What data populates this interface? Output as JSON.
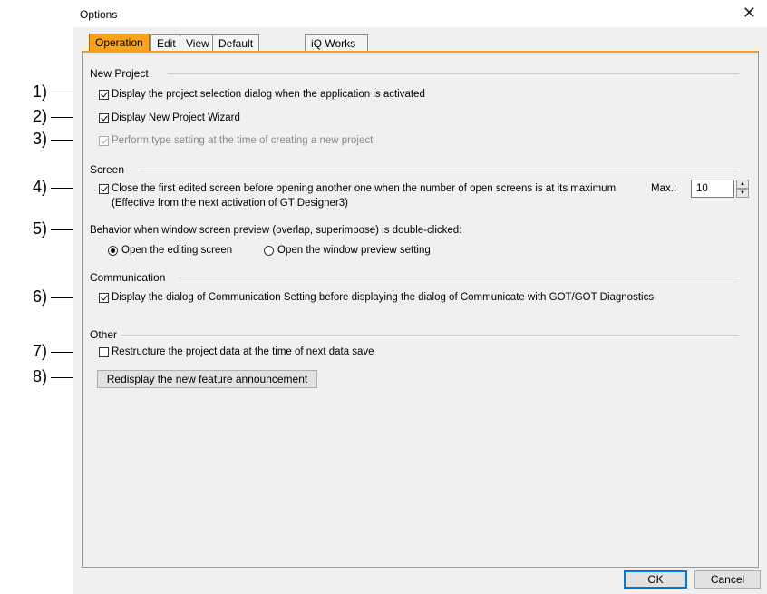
{
  "dialog": {
    "title": "Options"
  },
  "tabs": [
    "Operation",
    "Edit",
    "View",
    "Default Setting",
    "iQ Works Interaction"
  ],
  "callouts": [
    "1)",
    "2)",
    "3)",
    "4)",
    "5)",
    "6)",
    "7)",
    "8)"
  ],
  "sections": {
    "new_project": "New Project",
    "screen": "Screen",
    "communication": "Communication",
    "other": "Other"
  },
  "options": {
    "project_selection": "Display the project selection dialog when the application is activated",
    "new_project_wizard": "Display New Project Wizard",
    "type_setting": "Perform type setting at the time of creating a new project",
    "close_first_screen": "Close the first edited screen before opening another one when the number of open screens is at its maximum",
    "close_first_screen_note": "(Effective from the next activation of GT Designer3)",
    "max_label": "Max.:",
    "max_value": "10",
    "behavior_label": "Behavior when window screen preview (overlap, superimpose) is double-clicked:",
    "radio_open_editing": "Open the editing screen",
    "radio_open_preview": "Open the window preview setting",
    "comm_setting": "Display the dialog of Communication Setting before displaying the dialog of Communicate with GOT/GOT Diagnostics",
    "restructure": "Restructure the project data at the time of next data save",
    "redisplay_button": "Redisplay the new feature announcement"
  },
  "footer": {
    "ok": "OK",
    "cancel": "Cancel"
  },
  "colors": {
    "active_tab": "#f9a21a",
    "accent_border": "#f0a01e",
    "default_button_border": "#0078d7"
  }
}
